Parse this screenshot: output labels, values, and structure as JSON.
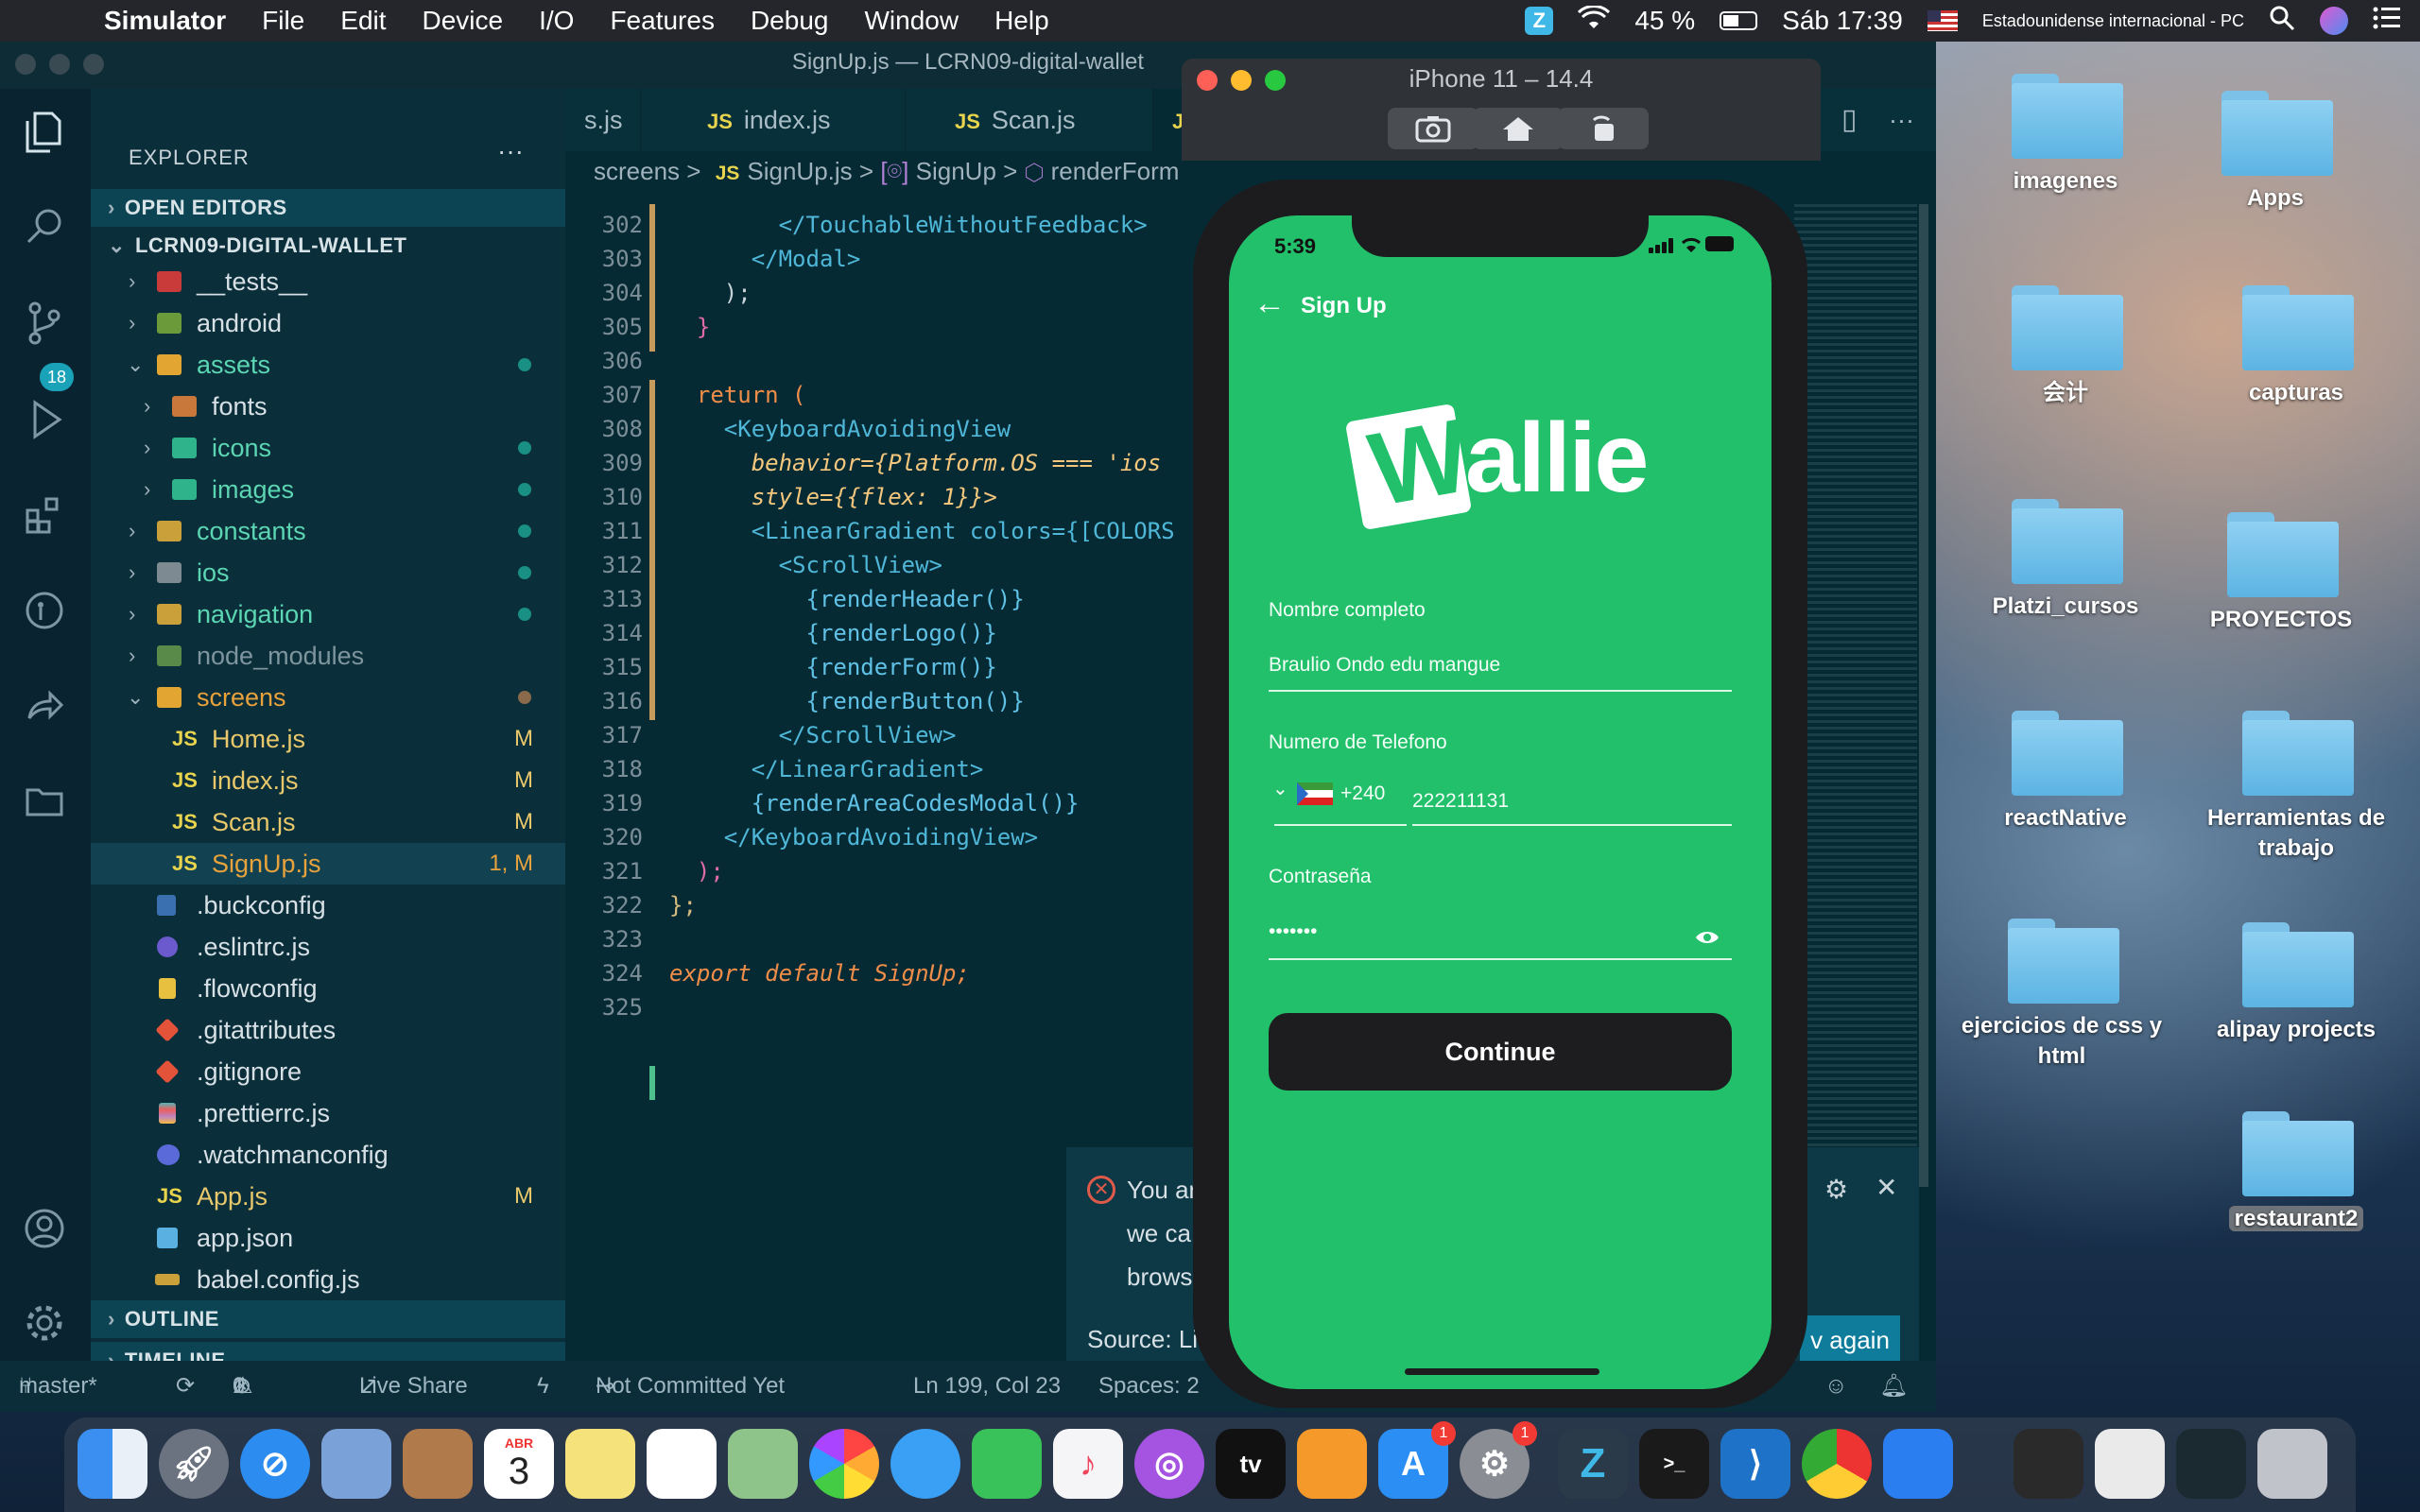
{
  "menubar": {
    "app_name": "Simulator",
    "items": [
      "File",
      "Edit",
      "Device",
      "I/O",
      "Features",
      "Debug",
      "Window",
      "Help"
    ],
    "battery": "45 %",
    "datetime": "Sáb 17:39",
    "input_source": "Estadounidense internacional - PC"
  },
  "vscode": {
    "window_title": "SignUp.js — LCRN09-digital-wallet",
    "explorer_title": "EXPLORER",
    "explorer_more": "···",
    "source_control_badge": "18",
    "sections": {
      "open_editors": "OPEN EDITORS",
      "project": "LCRN09-DIGITAL-WALLET",
      "outline": "OUTLINE",
      "timeline": "TIMELINE"
    },
    "tree": [
      {
        "label": "__tests__",
        "status": ""
      },
      {
        "label": "android",
        "status": ""
      },
      {
        "label": "assets",
        "status": ""
      },
      {
        "label": "fonts",
        "status": ""
      },
      {
        "label": "icons",
        "status": ""
      },
      {
        "label": "images",
        "status": ""
      },
      {
        "label": "constants",
        "status": ""
      },
      {
        "label": "ios",
        "status": ""
      },
      {
        "label": "navigation",
        "status": ""
      },
      {
        "label": "node_modules",
        "status": ""
      },
      {
        "label": "screens",
        "status": ""
      },
      {
        "label": "Home.js",
        "status": "M"
      },
      {
        "label": "index.js",
        "status": "M"
      },
      {
        "label": "Scan.js",
        "status": "M"
      },
      {
        "label": "SignUp.js",
        "status": "1, M"
      },
      {
        "label": ".buckconfig",
        "status": ""
      },
      {
        "label": ".eslintrc.js",
        "status": ""
      },
      {
        "label": ".flowconfig",
        "status": ""
      },
      {
        "label": ".gitattributes",
        "status": ""
      },
      {
        "label": ".gitignore",
        "status": ""
      },
      {
        "label": ".prettierrc.js",
        "status": ""
      },
      {
        "label": ".watchmanconfig",
        "status": ""
      },
      {
        "label": "App.js",
        "status": "M"
      },
      {
        "label": "app.json",
        "status": ""
      },
      {
        "label": "babel.config.js",
        "status": ""
      }
    ],
    "js_label": "JS",
    "tabs": [
      "s.js",
      "index.js",
      "Scan.js",
      "JS"
    ],
    "breadcrumb": {
      "folder": "screens",
      "sep": ">",
      "file": "SignUp.js",
      "symbol1": "SignUp",
      "symbol2": "renderForm"
    },
    "code": [
      {
        "ln": "302",
        "text": "        </TouchableWithoutFeedback>"
      },
      {
        "ln": "303",
        "text": "      </Modal>"
      },
      {
        "ln": "304",
        "text": "    );"
      },
      {
        "ln": "305",
        "text": "  }"
      },
      {
        "ln": "306",
        "text": ""
      },
      {
        "ln": "307",
        "text": "  return ("
      },
      {
        "ln": "308",
        "text": "    <KeyboardAvoidingView"
      },
      {
        "ln": "309",
        "text": "      behavior={Platform.OS === 'ios"
      },
      {
        "ln": "310",
        "text": "      style={{flex: 1}}>"
      },
      {
        "ln": "311",
        "text": "      <LinearGradient colors={[COLORS"
      },
      {
        "ln": "312",
        "text": "        <ScrollView>"
      },
      {
        "ln": "313",
        "text": "          {renderHeader()}"
      },
      {
        "ln": "314",
        "text": "          {renderLogo()}"
      },
      {
        "ln": "315",
        "text": "          {renderForm()}"
      },
      {
        "ln": "316",
        "text": "          {renderButton()}"
      },
      {
        "ln": "317",
        "text": "        </ScrollView>"
      },
      {
        "ln": "318",
        "text": "      </LinearGradient>"
      },
      {
        "ln": "319",
        "text": "      {renderAreaCodesModal()}"
      },
      {
        "ln": "320",
        "text": "    </KeyboardAvoidingView>"
      },
      {
        "ln": "321",
        "text": "  );"
      },
      {
        "ln": "322",
        "text": "};"
      },
      {
        "ln": "323",
        "text": ""
      },
      {
        "ln": "324",
        "text": "export default SignUp;"
      },
      {
        "ln": "325",
        "text": ""
      }
    ],
    "notification": {
      "line1": "You ar",
      "line2": "we ca",
      "line3": "brows",
      "source": "Source: Li",
      "button": "v again"
    },
    "status": {
      "branch": "master*",
      "errors": "0",
      "warnings": "1",
      "live_share": "Live Share",
      "commit": "Not Committed Yet",
      "position": "Ln 199, Col 23",
      "spaces": "Spaces: 2"
    }
  },
  "simulator": {
    "title": "iPhone 11 – 14.4",
    "phone": {
      "time": "5:39",
      "header_title": "Sign Up",
      "logo_text": "allie",
      "logo_letter": "W",
      "name_label": "Nombre completo",
      "name_value": "Braulio Ondo edu mangue",
      "phone_label": "Numero de Telefono",
      "area_code": "+240",
      "phone_value": "222211131",
      "password_label": "Contraseña",
      "password_value": "•••••••",
      "continue_label": "Continue",
      "primary_color": "#22c06b"
    }
  },
  "desktop": {
    "folders": [
      {
        "label": "imagenes"
      },
      {
        "label": "Apps"
      },
      {
        "label": "会计"
      },
      {
        "label": "capturas"
      },
      {
        "label": "Platzi_cursos"
      },
      {
        "label": "PROYECTOS"
      },
      {
        "label": "reactNative"
      },
      {
        "label": "Herramientas de trabajo"
      },
      {
        "label": "ejercicios de css y html"
      },
      {
        "label": "alipay projects"
      },
      {
        "label": "restaurant2"
      }
    ]
  },
  "dock": {
    "calendar_month": "ABR",
    "calendar_day": "3",
    "appletv": "tv",
    "badge_appstore": "1",
    "badge_settings": "1"
  }
}
